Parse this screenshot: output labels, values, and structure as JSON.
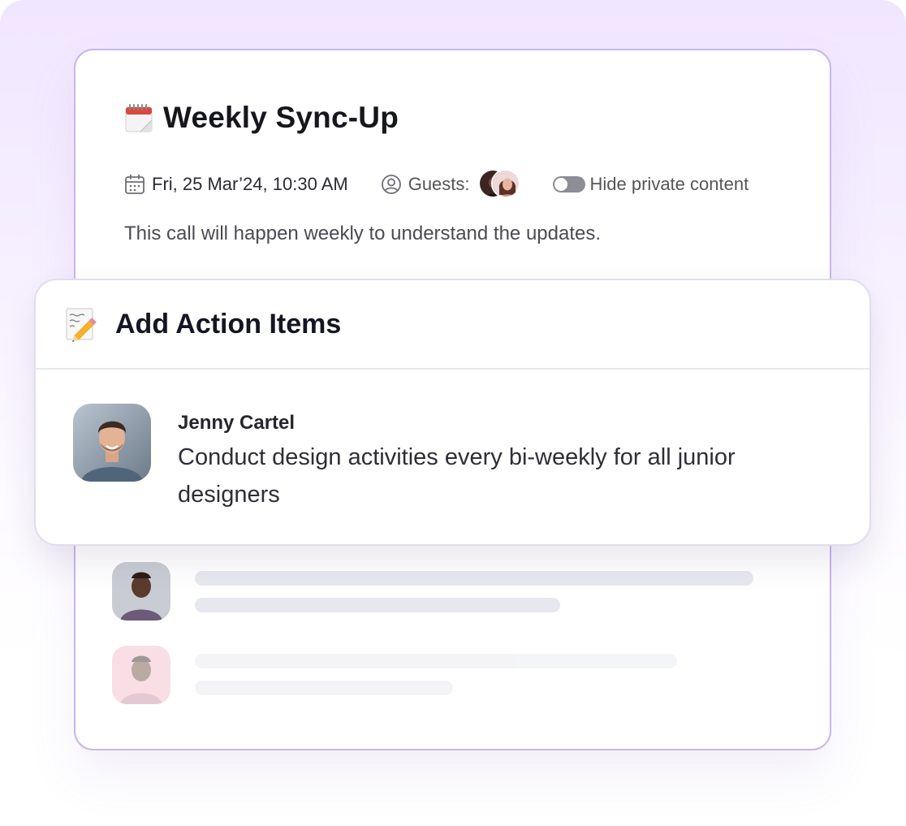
{
  "meeting": {
    "title": "Weekly Sync-Up",
    "date": "Fri, 25 Mar’24, 10:30 AM",
    "guests_label": "Guests:",
    "toggle_label": "Hide private content",
    "toggle_on": false,
    "description": "This call will happen weekly to understand the updates."
  },
  "action_panel": {
    "title": "Add Action Items",
    "item": {
      "assignee": "Jenny Cartel",
      "task": "Conduct design activities every bi-weekly for all junior designers"
    }
  },
  "icons": {
    "title": "calendar-emoji-icon",
    "date": "calendar-icon",
    "guests": "user-circle-icon",
    "action_panel": "memo-pencil-icon"
  },
  "colors": {
    "accent_border": "#c9b5f0",
    "background_top": "#f1e6ff",
    "skeleton": "#e7e8ef"
  }
}
